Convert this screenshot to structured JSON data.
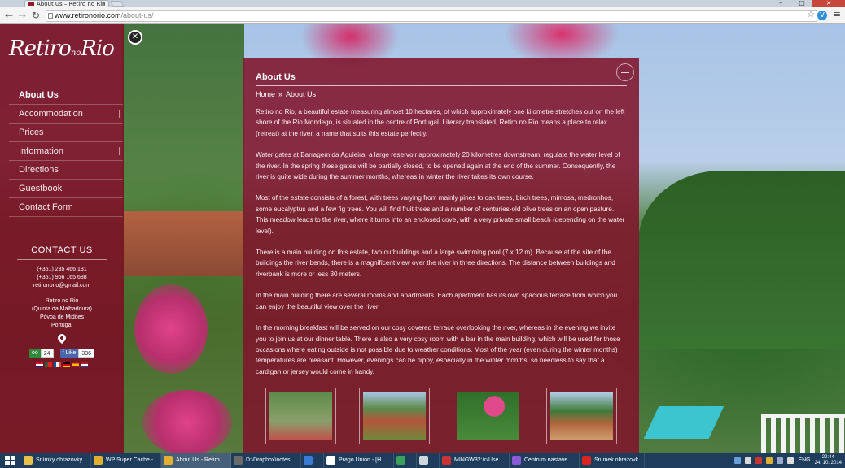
{
  "browser": {
    "tab_title": "About Us – Retiro no Rio",
    "url_host": "www.retironorio.com",
    "url_path": "/about-us/"
  },
  "sidebar": {
    "logo_text_1": "Retiro",
    "logo_text_small": "no",
    "logo_text_2": "Rio",
    "nav": [
      {
        "label": "About Us",
        "active": true
      },
      {
        "label": "Accommodation",
        "has_sub": true
      },
      {
        "label": "Prices"
      },
      {
        "label": "Information",
        "has_sub": true
      },
      {
        "label": "Directions"
      },
      {
        "label": "Guestbook"
      },
      {
        "label": "Contact Form"
      }
    ],
    "contact": {
      "title": "CONTACT US",
      "phone1": "(+351) 235 466 131",
      "phone2": "(+351) 966 165 688",
      "email": "retironorio@gmail.com",
      "addr1": "Retiro no Rio",
      "addr2": "(Quinta da Malhadoura)",
      "addr3": "Póvoa de Midões",
      "addr4": "Portugal"
    },
    "social": {
      "tripadvisor_count": "24",
      "facebook_label": "Like",
      "facebook_count": "336"
    }
  },
  "panel": {
    "title": "About Us",
    "breadcrumb_home": "Home",
    "breadcrumb_sep": "»",
    "breadcrumb_current": "About Us",
    "paragraphs": [
      "Retiro no Rio, a beautiful estate measuring almost 10 hectares, of which approximately one kilometre stretches out on the left shore of the Rio Mondego, is situated in the centre of Portugal. Literary translated, Retiro no Rio means a place to relax (retreat) at the river, a name that suits this estate perfectly.",
      "Water gates at Barragem da Aguieira, a large reservoir approximately 20 kilometres downstream, regulate the water level of the river. In the spring these gates will be partially closed, to be opened again at the end of the summer. Consequently, the river is quite wide during the summer months, whereas in winter the river takes its own course.",
      "Most of the estate consists of a forest, with trees varying from mainly pines to oak trees, birch trees, mimosa, medronhos, some eucalyptus and a few fig trees. You will find fruit trees and a number of centuries-old olive trees on an open pasture. This meadow leads to the river, where it turns into an enclosed cove, with a very private small beach (depending on the water level).",
      "There is a main building on this estate, two outbuildings and a large swimming pool (7 x 12 m). Because at the site of the buildings the river bends, there is a magnificent view over the river in three directions. The distance between buildings and riverbank is more or less 30 meters.",
      "In the main building there are several rooms and apartments. Each apartment has its own spacious terrace from which you can enjoy the beautiful view over the river.",
      "In the morning breakfast will be served on our cosy covered terrace overlooking the river, whereas in the evening we invite you to join us at our dinner table. There is also a very cosy room with a bar in the main building, which will be used for those occasions where eating outside is not possible due to weather conditions. Most of the year (even during the winter months) temperatures are pleasant. However, evenings can be nippy, especially in the winter months, so needless to say that a cardigan or jersey would come in handy."
    ]
  },
  "taskbar": {
    "items": [
      {
        "label": "Snímky obrazovky",
        "color": "#e8c14a"
      },
      {
        "label": "WP Super Cache -...",
        "color": "#e0b030"
      },
      {
        "label": "About Us - Retiro ...",
        "color": "#e0b030",
        "active": true
      },
      {
        "label": "D:\\Dropbox\\notes...",
        "color": "#6b6b6b"
      },
      {
        "label": "",
        "color": "#3a7bd5"
      },
      {
        "label": "Prago Union - [H...",
        "color": "#ffffff"
      },
      {
        "label": "",
        "color": "#3aa05a"
      },
      {
        "label": "",
        "color": "#cfd6de"
      },
      {
        "label": "MINGW32:/c/Use...",
        "color": "#c33"
      },
      {
        "label": "Centrum nastave...",
        "color": "#8a5ad6"
      },
      {
        "label": "Snímek obrazovk...",
        "color": "#d22"
      }
    ],
    "lang": "ENG",
    "time": "22:44",
    "date": "24. 10. 2014"
  }
}
